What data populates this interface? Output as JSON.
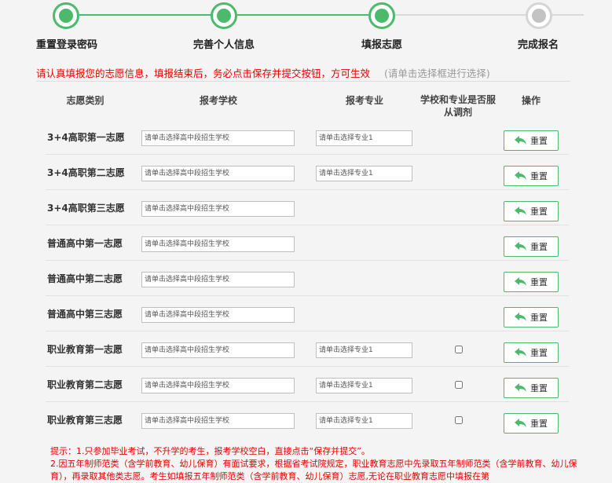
{
  "steps": [
    {
      "label": "重置登录密码",
      "state": "done"
    },
    {
      "label": "完善个人信息",
      "state": "done"
    },
    {
      "label": "填报志愿",
      "state": "done"
    },
    {
      "label": "完成报名",
      "state": "todo"
    }
  ],
  "notice": {
    "main": "请认真填报您的志愿信息，填报结束后，务必点击保存并提交按钮，方可生效",
    "hint": "(请单击选择框进行选择)"
  },
  "table": {
    "headers": {
      "category": "志愿类别",
      "school": "报考学校",
      "major": "报考专业",
      "adjust": "学校和专业是否服从调剂",
      "action": "操作"
    },
    "rows": [
      {
        "label": "3+4高职第一志愿",
        "school_placeholder": "请单击选择高中段招生学校",
        "major_placeholder": "请单击选择专业1"
      },
      {
        "label": "3+4高职第二志愿",
        "school_placeholder": "请单击选择高中段招生学校",
        "major_placeholder": "请单击选择专业1"
      },
      {
        "label": "3+4高职第三志愿",
        "school_placeholder": "请单击选择高中段招生学校"
      },
      {
        "label": "普通高中第一志愿",
        "school_placeholder": "请单击选择高中段招生学校"
      },
      {
        "label": "普通高中第二志愿",
        "school_placeholder": "请单击选择高中段招生学校"
      },
      {
        "label": "普通高中第三志愿",
        "school_placeholder": "请单击选择高中段招生学校"
      },
      {
        "label": "职业教育第一志愿",
        "school_placeholder": "请单击选择高中段招生学校",
        "major_placeholder": "请单击选择专业1",
        "adjust": true
      },
      {
        "label": "职业教育第二志愿",
        "school_placeholder": "请单击选择高中段招生学校",
        "major_placeholder": "请单击选择专业1",
        "adjust": true
      },
      {
        "label": "职业教育第三志愿",
        "school_placeholder": "请单击选择高中段招生学校",
        "major_placeholder": "请单击选择专业1",
        "adjust": true
      }
    ],
    "reset_label": "重置"
  },
  "tips": {
    "line1": "提示：1.只参加毕业考试，不升学的考生，报考学校空白，直接点击“保存并提交”。",
    "line2": "2.因五年制师范类（含学前教育、幼儿保育）有面试要求，根据省考试院规定，职业教育志愿中先录取五年制师范类（含学前教育、幼儿保育），再录取其他类志愿。考生如填报五年制师范类（含学前教育、幼儿保育）志愿,无论在职业教育志愿中填报在第"
  },
  "colors": {
    "accent": "#4cb96b",
    "warning": "#e60000",
    "hint": "#999999"
  }
}
